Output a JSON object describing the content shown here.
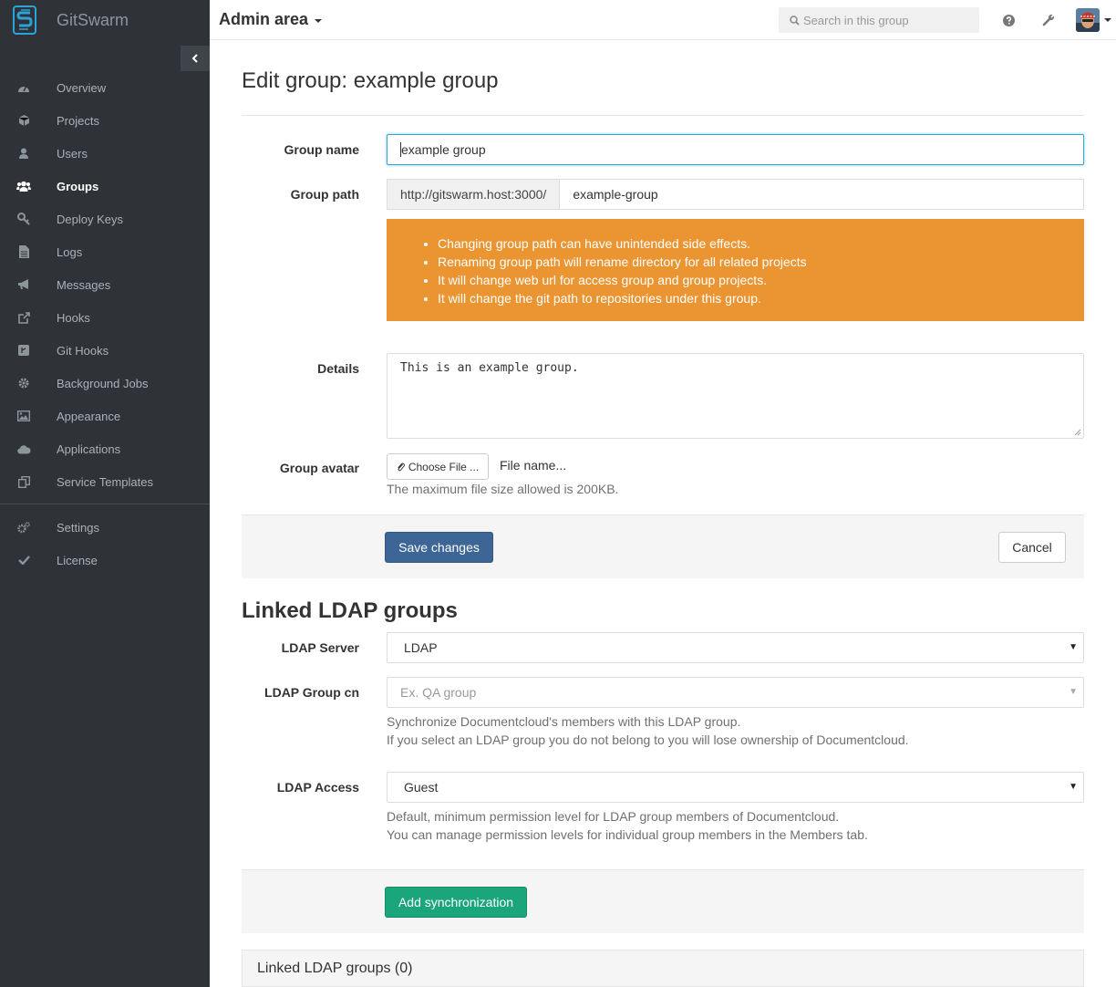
{
  "app": {
    "name": "GitSwarm"
  },
  "sidebar": {
    "items": [
      {
        "label": "Overview",
        "icon": "dashboard-icon"
      },
      {
        "label": "Projects",
        "icon": "cube-icon"
      },
      {
        "label": "Users",
        "icon": "user-icon"
      },
      {
        "label": "Groups",
        "icon": "users-icon",
        "active": true
      },
      {
        "label": "Deploy Keys",
        "icon": "key-icon"
      },
      {
        "label": "Logs",
        "icon": "file-text-icon"
      },
      {
        "label": "Messages",
        "icon": "bullhorn-icon"
      },
      {
        "label": "Hooks",
        "icon": "external-link-icon"
      },
      {
        "label": "Git Hooks",
        "icon": "git-square-icon"
      },
      {
        "label": "Background Jobs",
        "icon": "cog-icon"
      },
      {
        "label": "Appearance",
        "icon": "image-icon"
      },
      {
        "label": "Applications",
        "icon": "cloud-icon"
      },
      {
        "label": "Service Templates",
        "icon": "copy-icon"
      }
    ],
    "bottom_items": [
      {
        "label": "Settings",
        "icon": "cogs-icon"
      },
      {
        "label": "License",
        "icon": "check-icon"
      }
    ]
  },
  "header": {
    "title": "Admin area",
    "search_placeholder": "Search in this group"
  },
  "page": {
    "title": "Edit group: example group"
  },
  "form": {
    "group_name_label": "Group name",
    "group_name_value": "example group",
    "group_path_label": "Group path",
    "group_path_prefix": "http://gitswarm.host:3000/",
    "group_path_value": "example-group",
    "warnings": [
      "Changing group path can have unintended side effects.",
      "Renaming group path will rename directory for all related projects",
      "It will change web url for access group and group projects.",
      "It will change the git path to repositories under this group."
    ],
    "details_label": "Details",
    "details_value": "This is an example group.",
    "avatar_label": "Group avatar",
    "choose_file_label": "Choose File ...",
    "file_name_label": "File name...",
    "avatar_help": "The maximum file size allowed is 200KB.",
    "save_label": "Save changes",
    "cancel_label": "Cancel"
  },
  "ldap": {
    "section_title": "Linked LDAP groups",
    "server_label": "LDAP Server",
    "server_value": "LDAP",
    "group_cn_label": "LDAP Group cn",
    "group_cn_placeholder": "Ex. QA group",
    "group_cn_help_1": "Synchronize Documentcloud's members with this LDAP group.",
    "group_cn_help_2": "If you select an LDAP group you do not belong to you will lose ownership of Documentcloud.",
    "access_label": "LDAP Access",
    "access_value": "Guest",
    "access_help_1": "Default, minimum permission level for LDAP group members of Documentcloud.",
    "access_help_2": "You can manage permission levels for individual group members in the Members tab.",
    "add_sync_label": "Add synchronization",
    "linked_panel_title": "Linked LDAP groups (0)"
  },
  "colors": {
    "sidebar_bg": "#2f3337",
    "brand_accent": "#2aa3d8",
    "warning_bg": "#eb9532",
    "primary": "#3d6595",
    "success": "#1aa67a"
  }
}
